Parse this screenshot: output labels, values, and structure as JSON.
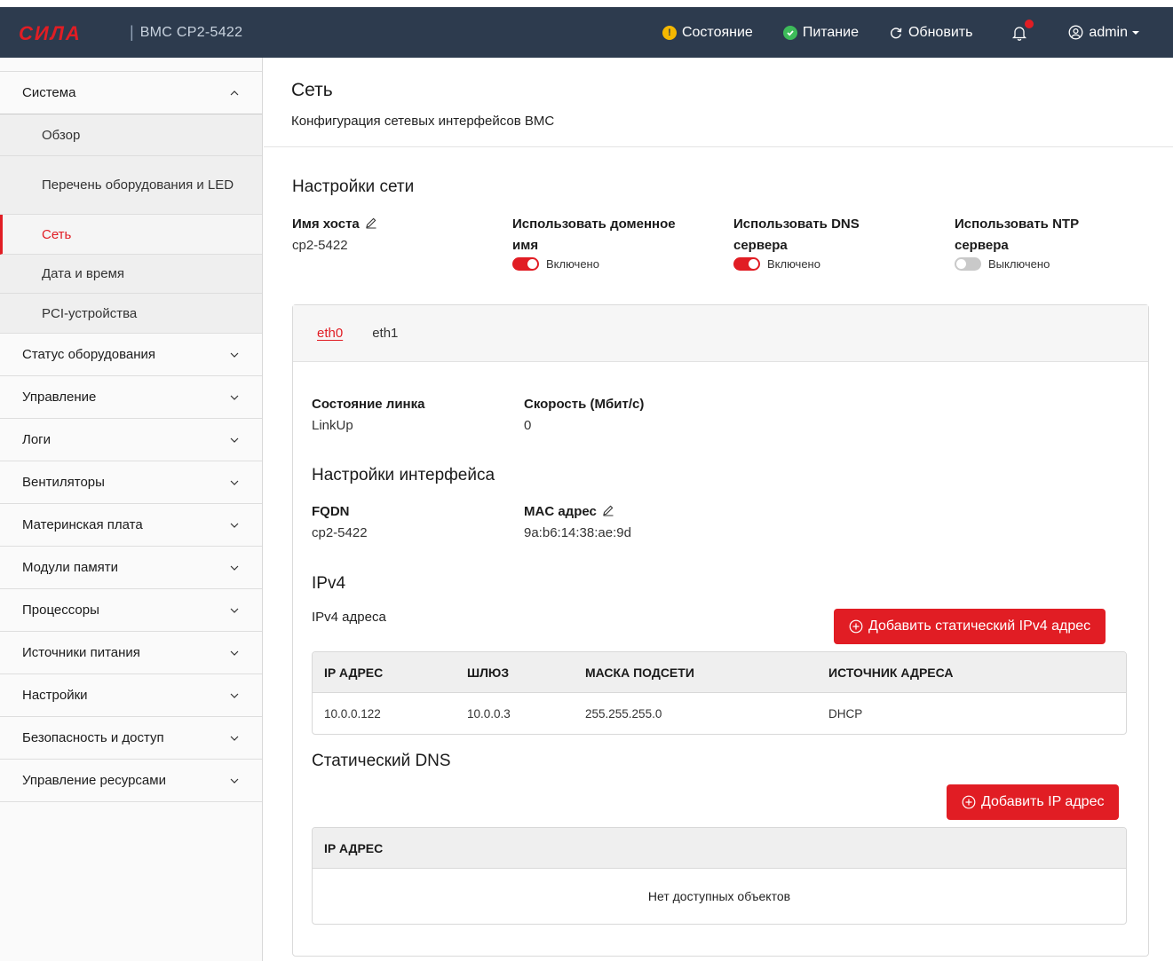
{
  "header": {
    "model": "BMC CP2-5422",
    "logo_text": "СИЛА",
    "status_label": "Состояние",
    "power_label": "Питание",
    "refresh_label": "Обновить",
    "user_label": "admin",
    "colors": {
      "bar": "#2d3b4e",
      "status_dot": "#f5b800",
      "power_dot": "#3dbb5a",
      "accent": "#e11d24"
    }
  },
  "sidebar": {
    "groups": [
      {
        "label": "Система",
        "open": true,
        "items": [
          {
            "label": "Обзор"
          },
          {
            "label": "Перечень оборудования и LED"
          },
          {
            "label": "Сеть",
            "active": true
          },
          {
            "label": "Дата и время"
          },
          {
            "label": "PCI-устройства"
          }
        ]
      },
      {
        "label": "Статус оборудования"
      },
      {
        "label": "Управление"
      },
      {
        "label": "Логи"
      },
      {
        "label": "Вентиляторы"
      },
      {
        "label": "Материнская плата"
      },
      {
        "label": "Модули памяти"
      },
      {
        "label": "Процессоры"
      },
      {
        "label": "Источники питания"
      },
      {
        "label": "Настройки"
      },
      {
        "label": "Безопасность и доступ"
      },
      {
        "label": "Управление ресурсами"
      }
    ]
  },
  "page": {
    "title": "Сеть",
    "subtitle": "Конфигурация сетевых интерфейсов BMC",
    "network_settings_title": "Настройки сети",
    "hostname": {
      "label": "Имя хоста",
      "value": "cp2-5422"
    },
    "use_domain": {
      "label_line1": "Использовать доменное",
      "label_line2": "имя",
      "state": "Включено",
      "on": true
    },
    "use_dns": {
      "label_line1": "Использовать DNS",
      "label_line2": "сервера",
      "state": "Включено",
      "on": true
    },
    "use_ntp": {
      "label_line1": "Использовать NTP",
      "label_line2": "сервера",
      "state": "Выключено",
      "on": false
    }
  },
  "interfaces": {
    "tabs": [
      "eth0",
      "eth1"
    ],
    "active_tab": "eth0",
    "link_state": {
      "label": "Состояние линка",
      "value": "LinkUp"
    },
    "speed": {
      "label": "Скорость (Мбит/с)",
      "value": "0"
    },
    "iface_settings_title": "Настройки интерфейса",
    "fqdn": {
      "label": "FQDN",
      "value": "cp2-5422"
    },
    "mac": {
      "label": "MAC адрес",
      "value": "9a:b6:14:38:ae:9d"
    },
    "ipv4": {
      "title": "IPv4",
      "addresses_label": "IPv4 адреса",
      "add_button": "Добавить статический IPv4 адрес",
      "columns": [
        "IP АДРЕС",
        "ШЛЮЗ",
        "МАСКА ПОДСЕТИ",
        "ИСТОЧНИК АДРЕСА"
      ],
      "rows": [
        [
          "10.0.0.122",
          "10.0.0.3",
          "255.255.255.0",
          "DHCP"
        ]
      ]
    },
    "dns": {
      "title": "Статический DNS",
      "add_button": "Добавить IP адрес",
      "columns": [
        "IP АДРЕС"
      ],
      "empty_text": "Нет доступных объектов"
    }
  }
}
